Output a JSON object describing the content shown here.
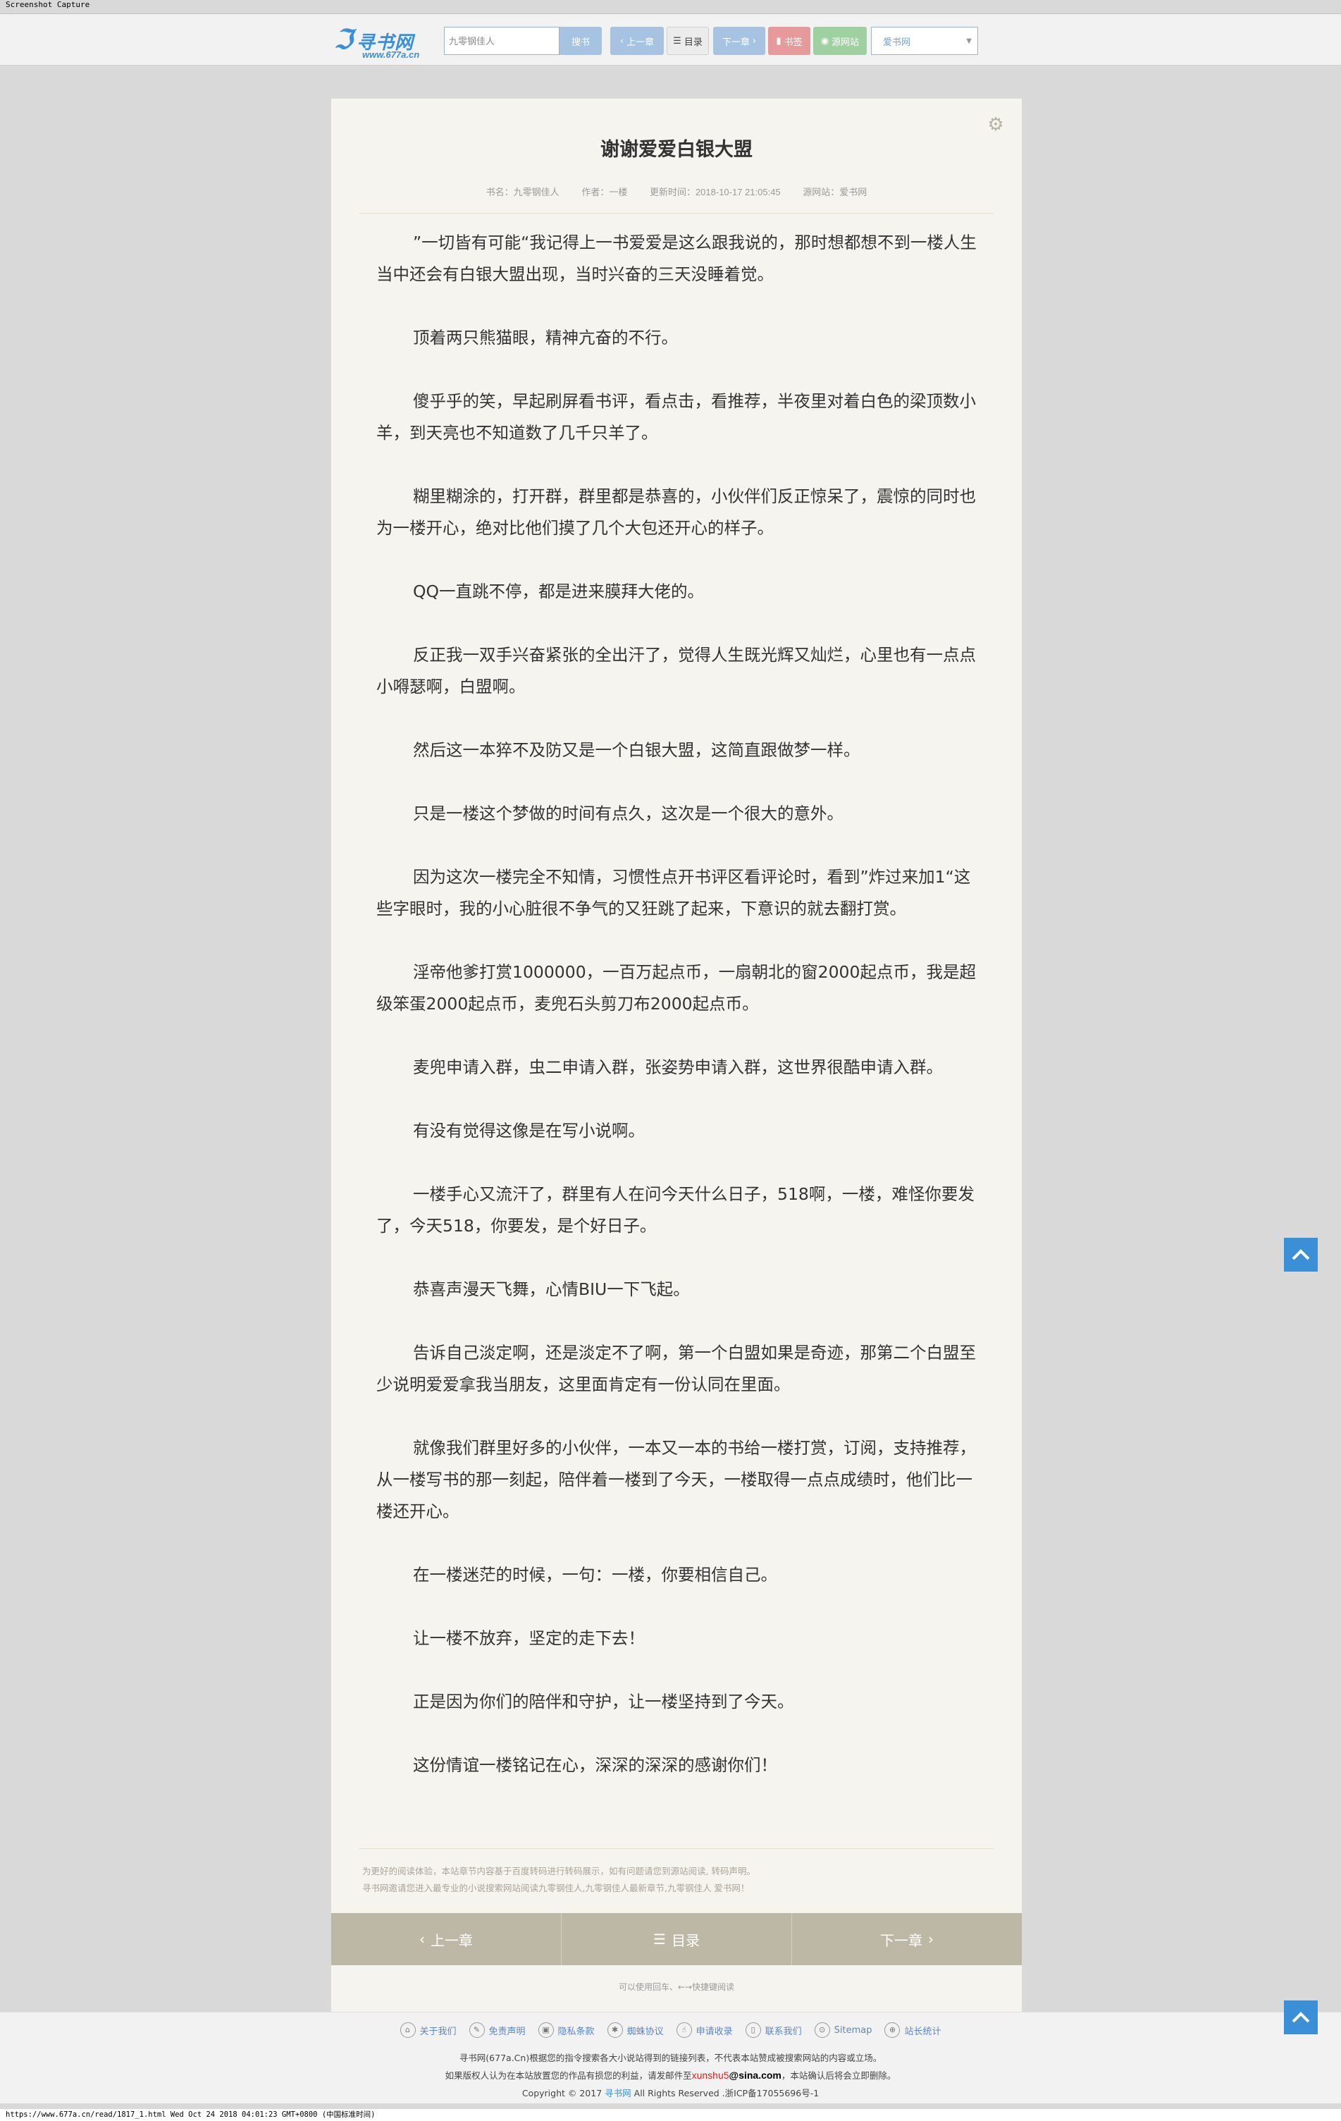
{
  "capture_label": "Screenshot Capture",
  "header": {
    "logo_name": "寻书网",
    "logo_url": "www.677a.cn",
    "search_placeholder": "九零钢佳人",
    "search_button": "搜书",
    "prev_button": "上一章",
    "toc_button": "目录",
    "next_button": "下一章",
    "bookmark_button": "书签",
    "source_button": "源网站",
    "source_select": "爱书网",
    "colors": {
      "primary": "#3b8fd6",
      "bookmark": "#e69a9a",
      "source": "#9fd09f"
    }
  },
  "chapter": {
    "title": "谢谢爱爱白银大盟",
    "book": "书名：九零钢佳人",
    "author": "作者：一楼",
    "updated": "更新时间：2018-10-17 21:05:45",
    "source_site": "源网站：爱书网",
    "paragraphs": [
      "”一切皆有可能“我记得上一书爱爱是这么跟我说的，那时想都想不到一楼人生当中还会有白银大盟出现，当时兴奋的三天没睡着觉。",
      "顶着两只熊猫眼，精神亢奋的不行。",
      "傻乎乎的笑，早起刷屏看书评，看点击，看推荐，半夜里对着白色的梁顶数小羊，到天亮也不知道数了几千只羊了。",
      "糊里糊涂的，打开群，群里都是恭喜的，小伙伴们反正惊呆了，震惊的同时也为一楼开心，绝对比他们摸了几个大包还开心的样子。",
      "QQ一直跳不停，都是进来膜拜大佬的。",
      "反正我一双手兴奋紧张的全出汗了，觉得人生既光辉又灿烂，心里也有一点点小嘚瑟啊，白盟啊。",
      "然后这一本猝不及防又是一个白银大盟，这简直跟做梦一样。",
      "只是一楼这个梦做的时间有点久，这次是一个很大的意外。",
      "因为这次一楼完全不知情，习惯性点开书评区看评论时，看到”炸过来加1“这些字眼时，我的小心脏很不争气的又狂跳了起来，下意识的就去翻打赏。",
      "淫帝他爹打赏1000000，一百万起点币，一扇朝北的窗2000起点币，我是超级笨蛋2000起点币，麦兜石头剪刀布2000起点币。",
      "麦兜申请入群，虫二申请入群，张姿势申请入群，这世界很酷申请入群。",
      "有没有觉得这像是在写小说啊。",
      "一楼手心又流汗了，群里有人在问今天什么日子，518啊，一楼，难怪你要发了，今天518，你要发，是个好日子。",
      "恭喜声漫天飞舞，心情BIU一下飞起。",
      "告诉自己淡定啊，还是淡定不了啊，第一个白盟如果是奇迹，那第二个白盟至少说明爱爱拿我当朋友，这里面肯定有一份认同在里面。",
      "就像我们群里好多的小伙伴，一本又一本的书给一楼打赏，订阅，支持推荐，从一楼写书的那一刻起，陪伴着一楼到了今天，一楼取得一点点成绩时，他们比一楼还开心。",
      "在一楼迷茫的时候，一句：一楼，你要相信自己。",
      "让一楼不放弃，坚定的走下去！",
      "正是因为你们的陪伴和守护，让一楼坚持到了今天。",
      "这份情谊一楼铭记在心，深深的深深的感谢你们！"
    ],
    "notice_lines": [
      "为更好的阅读体验，本站章节内容基于百度转码进行转码展示，如有问题请您到源站阅读, 转码声明。",
      "寻书网邀请您进入最专业的小说搜索网站阅读九零钢佳人,九零钢佳人最新章节,九零钢佳人 爱书网！"
    ],
    "nav": {
      "prev": "上一章",
      "toc": "目录",
      "next": "下一章"
    },
    "hint": "可以使用回车、←→快捷键阅读"
  },
  "footer": {
    "links": [
      {
        "icon": "home-icon",
        "label": "关于我们"
      },
      {
        "icon": "pencil-icon",
        "label": "免责声明"
      },
      {
        "icon": "lock-icon",
        "label": "隐私条款"
      },
      {
        "icon": "spider-icon",
        "label": "蜘蛛协议"
      },
      {
        "icon": "hand-icon",
        "label": "申请收录"
      },
      {
        "icon": "phone-icon",
        "label": "联系我们"
      },
      {
        "icon": "pin-icon",
        "label": "Sitemap"
      },
      {
        "icon": "globe-icon",
        "label": "站长统计"
      }
    ],
    "line1": "寻书网(677a.Cn)根据您的指令搜索各大小说站得到的链接列表，不代表本站赞成被搜索网站的内容或立场。",
    "line2_pre": "如果版权人认为在本站放置您的作品有损您的利益，请发邮件至",
    "email_user": "xunshu5",
    "email_at": "@",
    "email_domain": "sina",
    "email_tld": ".com",
    "line2_post": "，本站确认后将会立即删除。",
    "copyright_pre": "Copyright © 2017",
    "copyright_link": "寻书网",
    "copyright_post": "All Rights Reserved .浙ICP备17055696号-1"
  },
  "status_bar": "https://www.677a.cn/read/1817_1.html Wed Oct 24 2018 04:01:23 GMT+0800 (中国标准时间)"
}
